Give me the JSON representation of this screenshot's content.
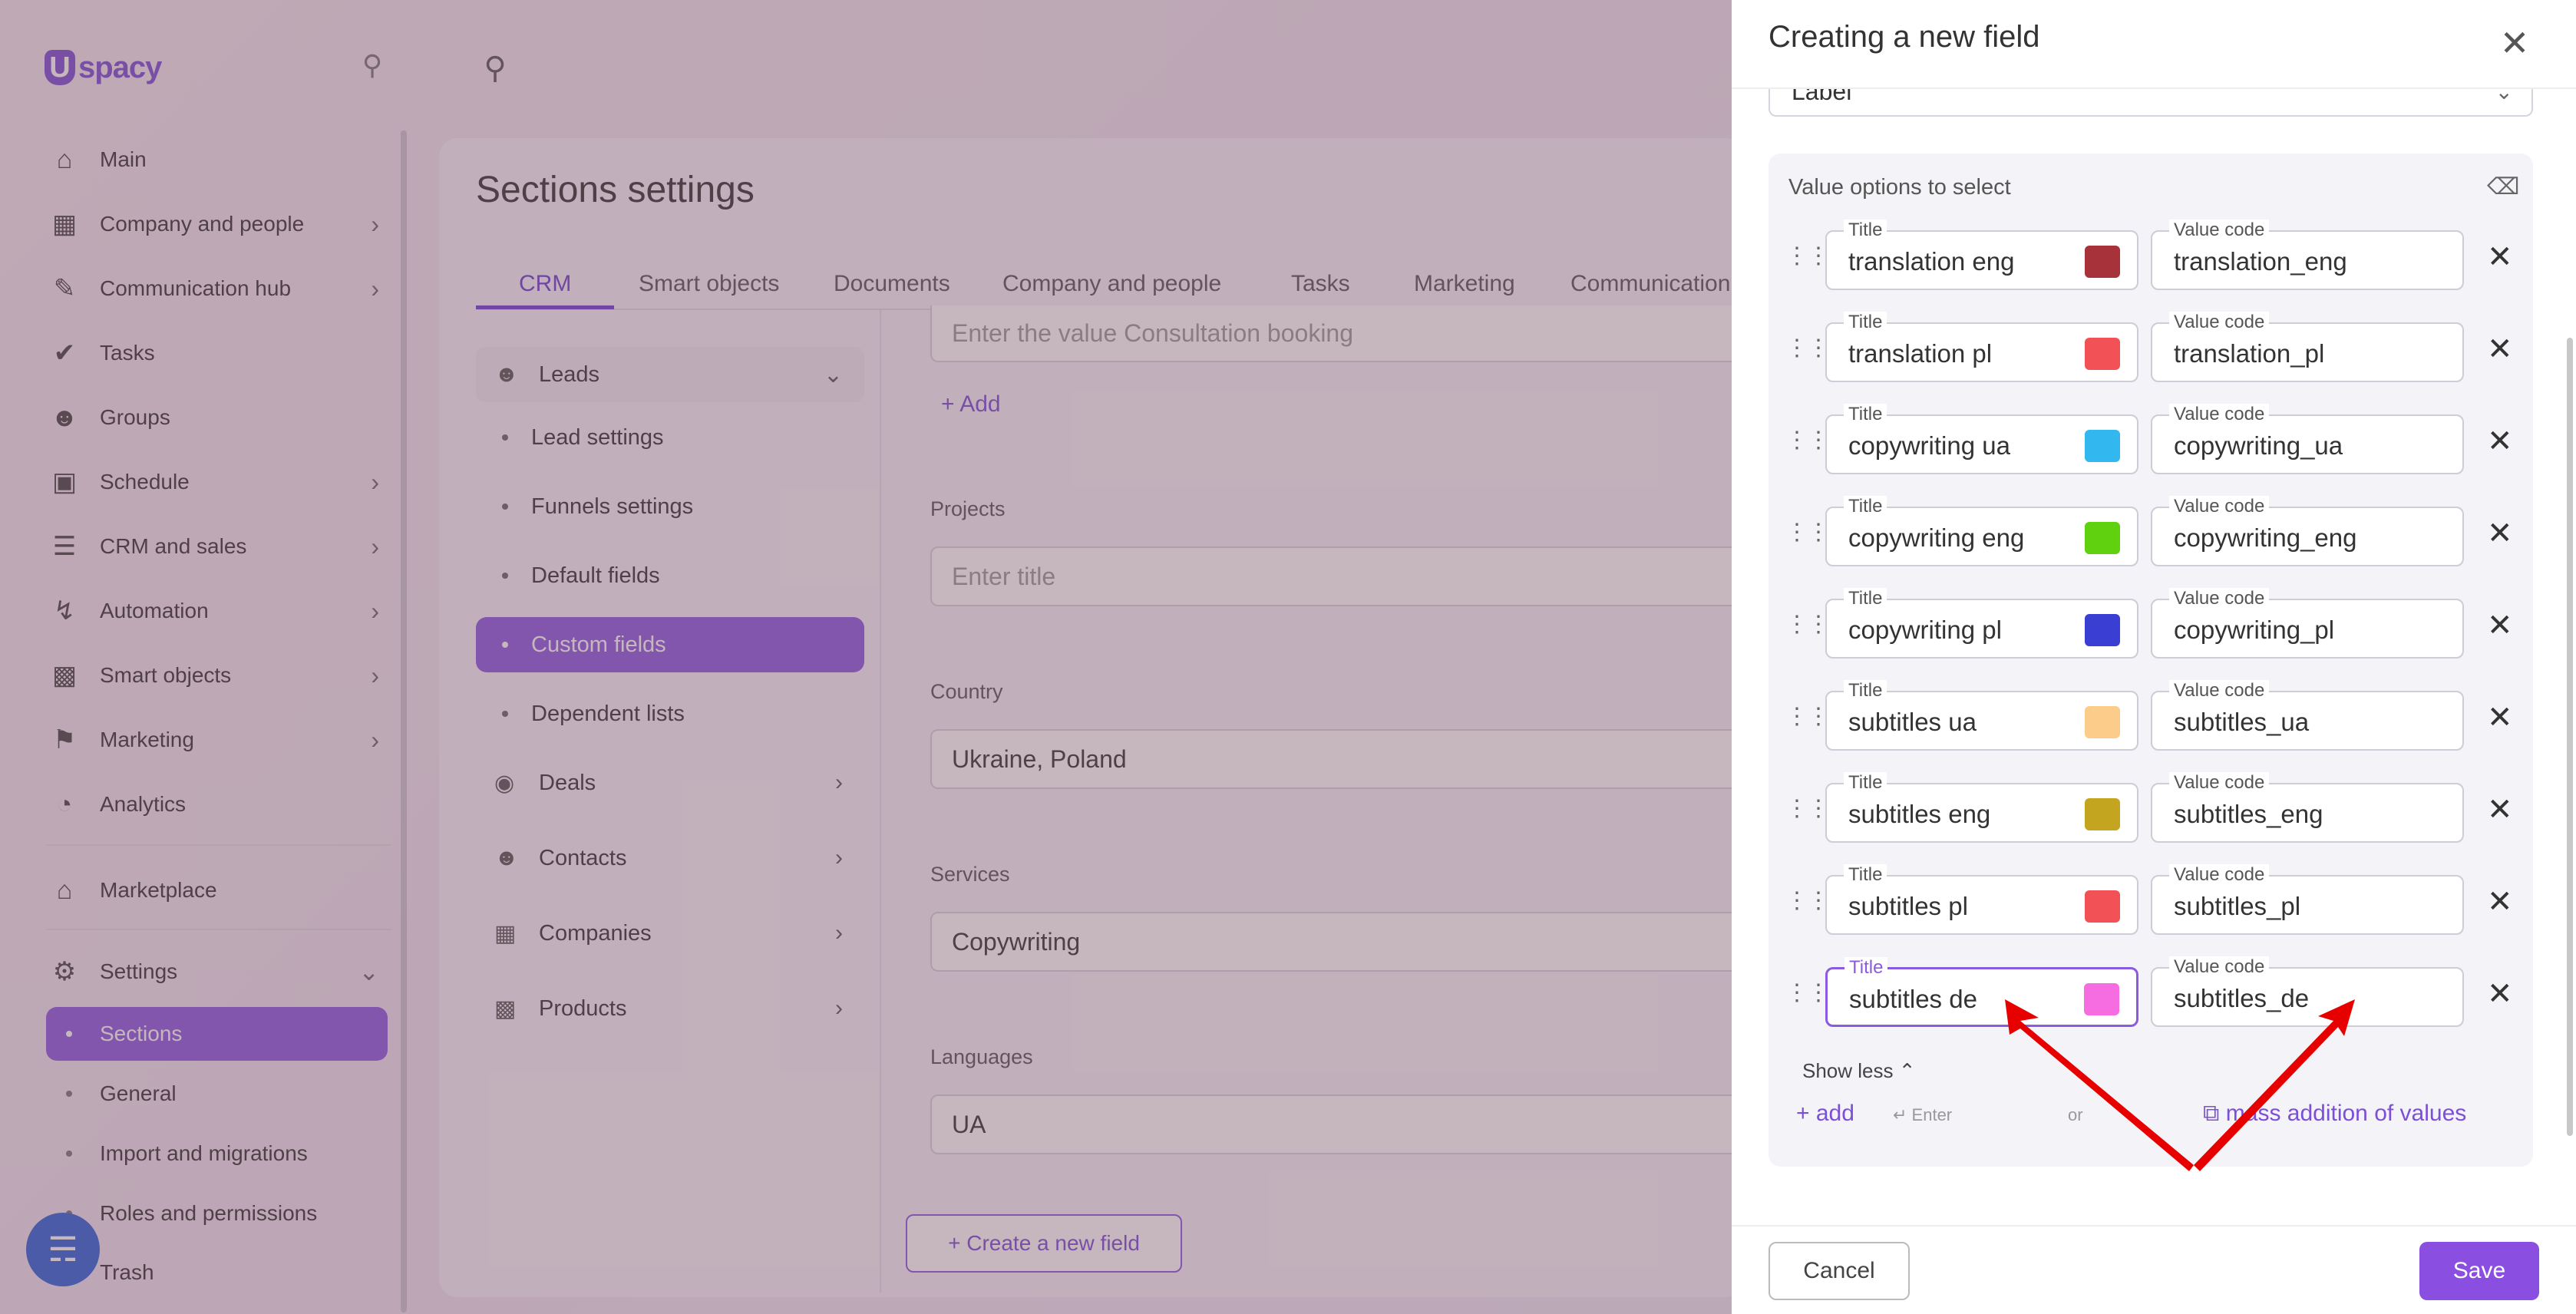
{
  "sidebar": {
    "logo_text": "spacy",
    "items": [
      {
        "label": "Main",
        "icon": "home-icon"
      },
      {
        "label": "Company and people",
        "icon": "building-icon"
      },
      {
        "label": "Communication hub",
        "icon": "chat-icon"
      },
      {
        "label": "Tasks",
        "icon": "check-circle-icon"
      },
      {
        "label": "Groups",
        "icon": "people-icon"
      },
      {
        "label": "Schedule",
        "icon": "calendar-icon"
      },
      {
        "label": "CRM and sales",
        "icon": "database-icon"
      },
      {
        "label": "Automation",
        "icon": "lightning-icon"
      },
      {
        "label": "Smart objects",
        "icon": "smart-object-icon"
      },
      {
        "label": "Marketing",
        "icon": "megaphone-icon"
      },
      {
        "label": "Analytics",
        "icon": "chart-icon"
      },
      {
        "label": "Marketplace",
        "icon": "store-icon"
      },
      {
        "label": "Settings",
        "icon": "gear-icon"
      }
    ],
    "settings_sub": [
      "Sections",
      "General",
      "Import and migrations",
      "Roles and permissions",
      "Trash"
    ]
  },
  "main": {
    "title": "Sections settings",
    "tabs": [
      "CRM",
      "Smart objects",
      "Documents",
      "Company and people",
      "Tasks",
      "Marketing",
      "Communication"
    ],
    "left_menu": {
      "leads": "Leads",
      "lead_subs": [
        "Lead settings",
        "Funnels settings",
        "Default fields",
        "Custom fields",
        "Dependent lists"
      ],
      "deals": "Deals",
      "contacts": "Contacts",
      "companies": "Companies",
      "products": "Products"
    },
    "top_placeholder": "Enter the value Consultation booking",
    "add_label": "Add",
    "fields": [
      {
        "label": "Projects",
        "value": "Enter title"
      },
      {
        "label": "Country",
        "value": "Ukraine, Poland"
      },
      {
        "label": "Services",
        "value": "Copywriting"
      },
      {
        "label": "Languages",
        "value": "UA"
      }
    ],
    "create_button": "Create a new field"
  },
  "modal": {
    "title": "Creating a new field",
    "type_value": "Label",
    "value_options_title": "Value options to select",
    "title_label": "Title",
    "code_label": "Value code",
    "rows": [
      {
        "title": "translation eng",
        "code": "translation_eng",
        "color": "#a8323a"
      },
      {
        "title": "translation pl",
        "code": "translation_pl",
        "color": "#f25155"
      },
      {
        "title": "copywriting ua",
        "code": "copywriting_ua",
        "color": "#32b8ee"
      },
      {
        "title": "copywriting eng",
        "code": "copywriting_eng",
        "color": "#5fd10f"
      },
      {
        "title": "copywriting pl",
        "code": "copywriting_pl",
        "color": "#3b3ed2"
      },
      {
        "title": "subtitles ua",
        "code": "subtitles_ua",
        "color": "#fccd8a"
      },
      {
        "title": "subtitles eng",
        "code": "subtitles_eng",
        "color": "#c4a51f"
      },
      {
        "title": "subtitles pl",
        "code": "subtitles_pl",
        "color": "#f25155"
      },
      {
        "title": "subtitles de",
        "code": "subtitles_de",
        "color": "#f56de0"
      }
    ],
    "show_less": "Show less",
    "add_label": "add",
    "enter_hint": "Enter",
    "or_label": "or",
    "mass_addition": "mass addition of values",
    "cancel": "Cancel",
    "save": "Save"
  },
  "colors": {
    "accent": "#8a4fe0",
    "annotation_arrow": "#e60000"
  }
}
